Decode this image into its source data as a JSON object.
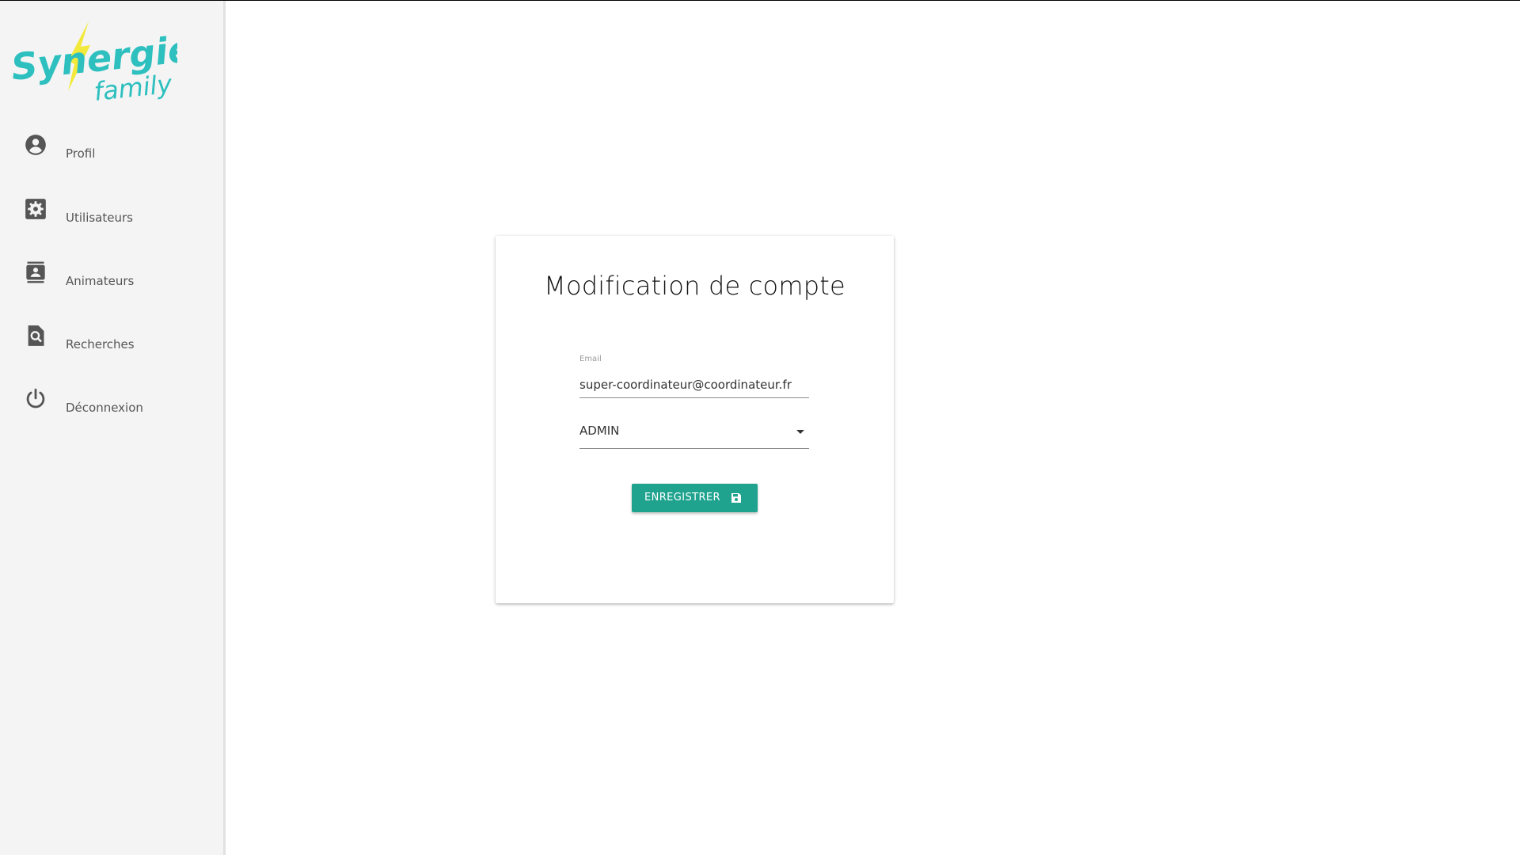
{
  "brand": {
    "logo_text_line1": "Synergie",
    "logo_text_line2": "family",
    "primary_color": "#2ebfbf",
    "accent_color": "#f2e93a"
  },
  "sidebar": {
    "items": [
      {
        "label": "Profil",
        "icon": "account-circle-icon"
      },
      {
        "label": "Utilisateurs",
        "icon": "settings-box-icon"
      },
      {
        "label": "Animateurs",
        "icon": "contacts-icon"
      },
      {
        "label": "Recherches",
        "icon": "search-document-icon"
      },
      {
        "label": "Déconnexion",
        "icon": "power-icon"
      }
    ]
  },
  "form": {
    "title": "Modification de compte",
    "email_label": "Email",
    "email_value": "super-coordinateur@coordinateur.fr",
    "role_value": "ADMIN",
    "save_label": "ENREGISTRER",
    "save_icon": "floppy-disk-icon",
    "button_color": "#1fa38f"
  }
}
